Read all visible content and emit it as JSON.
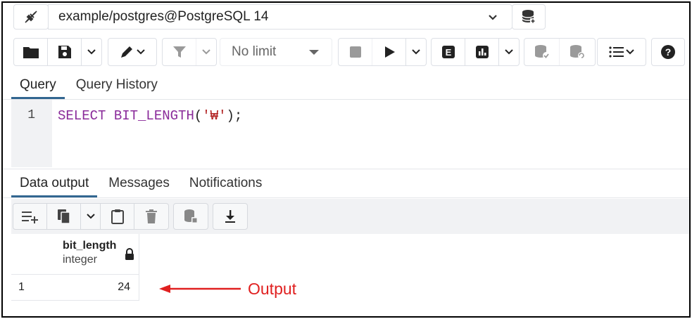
{
  "connection": {
    "label": "example/postgres@PostgreSQL 14"
  },
  "toolbar": {
    "limit_value": "No limit"
  },
  "editor_tabs": [
    {
      "label": "Query",
      "active": true
    },
    {
      "label": "Query History",
      "active": false
    }
  ],
  "editor": {
    "line_number": "1",
    "code_keyword": "SELECT",
    "code_function": "BIT_LENGTH",
    "code_open": "(",
    "code_string": "'₩'",
    "code_close": ");"
  },
  "output_tabs": [
    {
      "label": "Data output",
      "active": true
    },
    {
      "label": "Messages",
      "active": false
    },
    {
      "label": "Notifications",
      "active": false
    }
  ],
  "result": {
    "column_name": "bit_length",
    "column_type": "integer",
    "rows": [
      {
        "row_number": "1",
        "value": "24"
      }
    ]
  },
  "annotation": {
    "text": "Output",
    "color": "#e02020"
  },
  "colors": {
    "accent": "#326690",
    "keyword": "#8a2b9a",
    "string": "#b22222"
  }
}
